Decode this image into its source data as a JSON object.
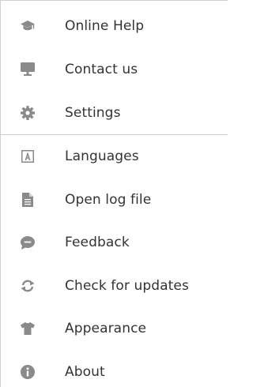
{
  "menu": {
    "top_items": [
      {
        "label": "Online Help",
        "icon": "graduation-cap-icon"
      },
      {
        "label": "Contact us",
        "icon": "monitor-icon"
      },
      {
        "label": "Settings",
        "icon": "gear-icon"
      }
    ],
    "bottom_items": [
      {
        "label": "Languages",
        "icon": "language-icon"
      },
      {
        "label": "Open log file",
        "icon": "file-icon"
      },
      {
        "label": "Feedback",
        "icon": "chat-bubble-icon"
      },
      {
        "label": "Check for updates",
        "icon": "refresh-icon"
      },
      {
        "label": "Appearance",
        "icon": "tshirt-icon"
      },
      {
        "label": "About",
        "icon": "info-icon"
      }
    ]
  },
  "colors": {
    "icon": "#8a8a8a",
    "text": "#333333",
    "divider": "#cfcfcf"
  }
}
